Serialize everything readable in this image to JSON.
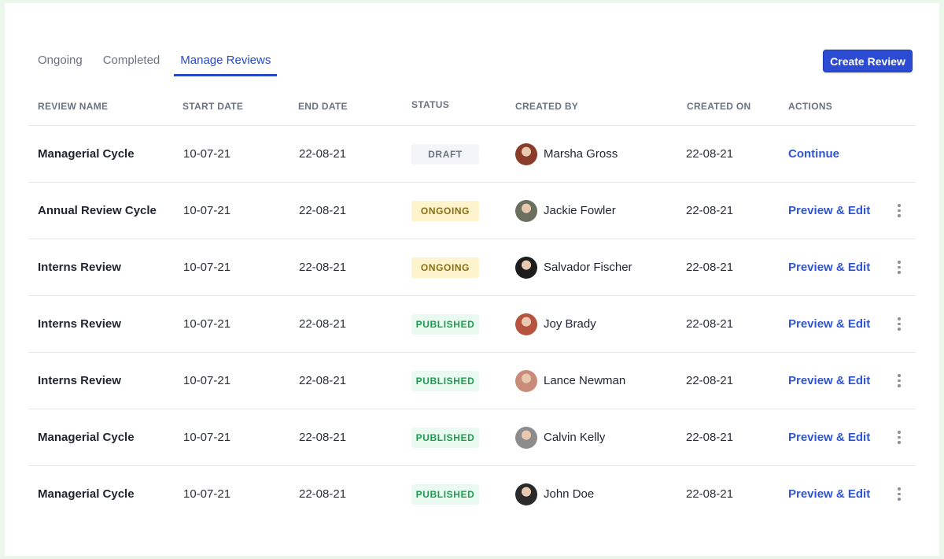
{
  "tabs": [
    {
      "label": "Ongoing",
      "active": false
    },
    {
      "label": "Completed",
      "active": false
    },
    {
      "label": "Manage Reviews",
      "active": true
    }
  ],
  "create_button": "Create Review",
  "columns": {
    "review_name": "REVIEW NAME",
    "start_date": "START DATE",
    "end_date": "END DATE",
    "status": "STATUS",
    "created_by": "CREATED BY",
    "created_on": "CREATED ON",
    "actions": "ACTIONS"
  },
  "rows": [
    {
      "name": "Managerial Cycle",
      "start": "10-07-21",
      "end": "22-08-21",
      "status": "DRAFT",
      "status_type": "draft",
      "creator": "Marsha Gross",
      "created_on": "22-08-21",
      "action": "Continue",
      "has_menu": false,
      "avatar_color": "#8a3b2a"
    },
    {
      "name": "Annual Review Cycle",
      "start": "10-07-21",
      "end": "22-08-21",
      "status": "ONGOING",
      "status_type": "ongoing",
      "creator": "Jackie Fowler",
      "created_on": "22-08-21",
      "action": "Preview & Edit",
      "has_menu": true,
      "avatar_color": "#6b6f5e"
    },
    {
      "name": "Interns Review",
      "start": "10-07-21",
      "end": "22-08-21",
      "status": "ONGOING",
      "status_type": "ongoing",
      "creator": "Salvador Fischer",
      "created_on": "22-08-21",
      "action": "Preview & Edit",
      "has_menu": true,
      "avatar_color": "#1c1c1c"
    },
    {
      "name": "Interns Review",
      "start": "10-07-21",
      "end": "22-08-21",
      "status": "PUBLISHED",
      "status_type": "published",
      "creator": "Joy Brady",
      "created_on": "22-08-21",
      "action": "Preview & Edit",
      "has_menu": true,
      "avatar_color": "#b5533f"
    },
    {
      "name": "Interns Review",
      "start": "10-07-21",
      "end": "22-08-21",
      "status": "PUBLISHED",
      "status_type": "published",
      "creator": "Lance Newman",
      "created_on": "22-08-21",
      "action": "Preview & Edit",
      "has_menu": true,
      "avatar_color": "#c98b7a"
    },
    {
      "name": "Managerial Cycle",
      "start": "10-07-21",
      "end": "22-08-21",
      "status": "PUBLISHED",
      "status_type": "published",
      "creator": "Calvin Kelly",
      "created_on": "22-08-21",
      "action": "Preview & Edit",
      "has_menu": true,
      "avatar_color": "#8c8c8c"
    },
    {
      "name": "Managerial Cycle",
      "start": "10-07-21",
      "end": "22-08-21",
      "status": "PUBLISHED",
      "status_type": "published",
      "creator": "John Doe",
      "created_on": "22-08-21",
      "action": "Preview & Edit",
      "has_menu": true,
      "avatar_color": "#2a2a2a"
    }
  ]
}
